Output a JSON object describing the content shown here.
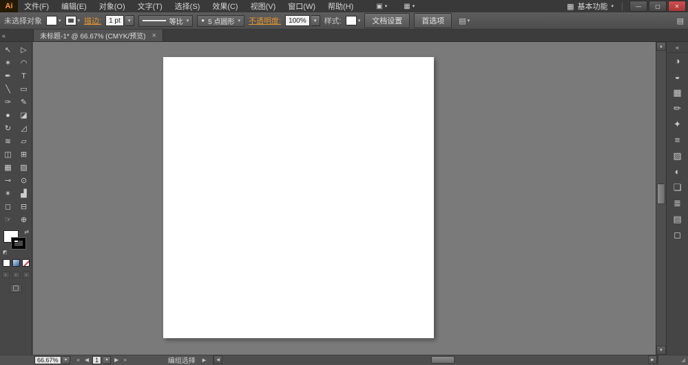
{
  "colors": {
    "accent_orange": "#e6962f",
    "logo_orange": "#ff9c2a",
    "close_red": "#b94040",
    "chrome_gray": "#535353",
    "canvas_gray": "#7a7a7a",
    "artboard_white": "#ffffff"
  },
  "menubar": {
    "logo": "Ai",
    "menus": [
      {
        "id": "file",
        "label": "文件(F)"
      },
      {
        "id": "edit",
        "label": "编辑(E)"
      },
      {
        "id": "object",
        "label": "对象(O)"
      },
      {
        "id": "type",
        "label": "文字(T)"
      },
      {
        "id": "select",
        "label": "选择(S)"
      },
      {
        "id": "effect",
        "label": "效果(C)"
      },
      {
        "id": "view",
        "label": "视图(V)"
      },
      {
        "id": "window",
        "label": "窗口(W)"
      },
      {
        "id": "help",
        "label": "帮助(H)"
      }
    ],
    "arrange_documents_glyph": "▣",
    "document_layout_glyph": "▦",
    "workspace_glyph": "▦",
    "workspace_label": "基本功能",
    "chevron": "▾",
    "minimize_glyph": "—",
    "maximize_glyph": "▢",
    "close_glyph": "✕"
  },
  "control_bar": {
    "selection_status": "未选择对象",
    "stroke_label": "描边:",
    "stroke_width": "1 pt",
    "profile_label": "等比",
    "brush_bullet": "●",
    "brush_name": "5 点圆形",
    "opacity_label": "不透明度:",
    "opacity_value": "100%",
    "style_label": "样式:",
    "document_setup_label": "文档设置",
    "preferences_label": "首选项",
    "chevron": "▾",
    "flyout_glyph": "▤"
  },
  "tab": {
    "collapse_glyph": "«",
    "title": "未标题-1* @ 66.67% (CMYK/预览)",
    "close_glyph": "×"
  },
  "tools": [
    {
      "name": "selection-tool",
      "glyph": "↖"
    },
    {
      "name": "direct-selection-tool",
      "glyph": "▷"
    },
    {
      "name": "magic-wand-tool",
      "glyph": "✶"
    },
    {
      "name": "lasso-tool",
      "glyph": "◠"
    },
    {
      "name": "pen-tool",
      "glyph": "✒"
    },
    {
      "name": "type-tool",
      "glyph": "T"
    },
    {
      "name": "line-segment-tool",
      "glyph": "╲"
    },
    {
      "name": "rectangle-tool",
      "glyph": "▭"
    },
    {
      "name": "paintbrush-tool",
      "glyph": "✑"
    },
    {
      "name": "pencil-tool",
      "glyph": "✎"
    },
    {
      "name": "blob-brush-tool",
      "glyph": "●"
    },
    {
      "name": "eraser-tool",
      "glyph": "◪"
    },
    {
      "name": "rotate-tool",
      "glyph": "↻"
    },
    {
      "name": "scale-tool",
      "glyph": "◿"
    },
    {
      "name": "width-tool",
      "glyph": "≋"
    },
    {
      "name": "free-transform-tool",
      "glyph": "▱"
    },
    {
      "name": "shape-builder-tool",
      "glyph": "◫"
    },
    {
      "name": "perspective-grid-tool",
      "glyph": "⊞"
    },
    {
      "name": "mesh-tool",
      "glyph": "▦"
    },
    {
      "name": "gradient-tool",
      "glyph": "▨"
    },
    {
      "name": "eyedropper-tool",
      "glyph": "⊸"
    },
    {
      "name": "blend-tool",
      "glyph": "⊙"
    },
    {
      "name": "symbol-sprayer-tool",
      "glyph": "✴"
    },
    {
      "name": "column-graph-tool",
      "glyph": "▟"
    },
    {
      "name": "artboard-tool",
      "glyph": "◻"
    },
    {
      "name": "slice-tool",
      "glyph": "⊟"
    },
    {
      "name": "hand-tool",
      "glyph": "☞"
    },
    {
      "name": "zoom-tool",
      "glyph": "⊕"
    }
  ],
  "toolbar": {
    "swap_glyph": "⇄",
    "default_swatches_glyph": "◩",
    "draw_modes": [
      {
        "name": "draw-normal-mode",
        "glyph": "▫"
      },
      {
        "name": "draw-behind-mode",
        "glyph": "▫"
      },
      {
        "name": "draw-inside-mode",
        "glyph": "▫"
      }
    ],
    "screen_mode_glyph": "▢"
  },
  "panels": {
    "collapse_glyph": "«",
    "items": [
      {
        "name": "color-panel",
        "glyph": "◑"
      },
      {
        "name": "color-guide-panel",
        "glyph": "◒"
      },
      {
        "name": "swatches-panel",
        "glyph": "▦"
      },
      {
        "name": "brushes-panel",
        "glyph": "✏"
      },
      {
        "name": "symbols-panel",
        "glyph": "✦"
      },
      {
        "name": "stroke-panel",
        "glyph": "≡"
      },
      {
        "name": "gradient-panel",
        "glyph": "▨"
      },
      {
        "name": "transparency-panel",
        "glyph": "◐"
      },
      {
        "name": "graphic-styles-panel",
        "glyph": "❏"
      },
      {
        "name": "appearance-panel",
        "glyph": "≣"
      },
      {
        "name": "layers-panel",
        "glyph": "▤"
      },
      {
        "name": "artboards-panel",
        "glyph": "◻"
      }
    ]
  },
  "scrollbars": {
    "up_glyph": "▲",
    "down_glyph": "▼",
    "left_glyph": "◀",
    "right_glyph": "▶"
  },
  "status_bar": {
    "zoom": "66.67%",
    "chevron": "▾",
    "first_glyph": "«",
    "prev_glyph": "◀",
    "artboard_number": "1",
    "next_glyph": "▶",
    "last_glyph": "»",
    "status_text": "编组选择",
    "flyout_glyph": "▶",
    "grip_glyph": "◢"
  }
}
